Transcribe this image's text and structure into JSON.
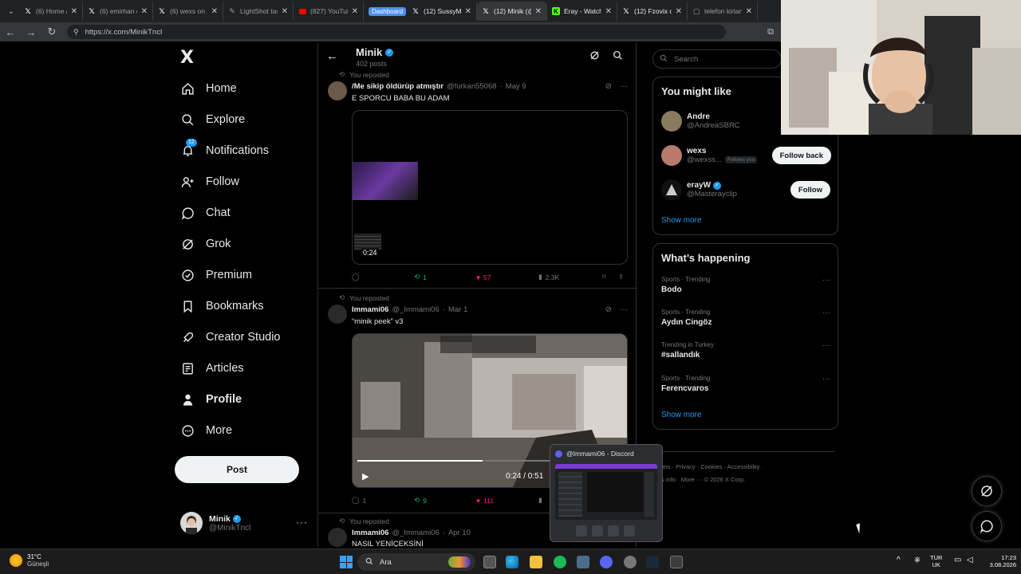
{
  "browser": {
    "tabs": [
      {
        "label": "(6) Home / X",
        "icon": "x-icon",
        "active": false
      },
      {
        "label": "(6) emirhan on X",
        "icon": "x-icon",
        "active": false
      },
      {
        "label": "(6) wexs on X",
        "icon": "x-icon",
        "active": false
      },
      {
        "label": "LightShot taslak",
        "icon": "feather-icon",
        "active": false
      },
      {
        "label": "(827) YouTube",
        "icon": "youtube-icon",
        "active": false
      },
      {
        "label": "Dashboard",
        "icon": "group-chip",
        "active": false
      },
      {
        "label": "(12) SussyMo...",
        "icon": "x-icon",
        "active": false
      },
      {
        "label": "(12) Minik (@...",
        "icon": "x-icon",
        "active": true
      },
      {
        "label": "Eray - Watch ...",
        "icon": "kick-icon",
        "active": false
      },
      {
        "label": "(12) Fzovix on...",
        "icon": "x-icon",
        "active": false
      },
      {
        "label": "telefon kirlan...",
        "icon": "page-icon",
        "active": false
      }
    ],
    "url": "https://x.com/MinikTncl"
  },
  "nav": {
    "logo": "X",
    "items": [
      {
        "label": "Home",
        "icon": "home-icon"
      },
      {
        "label": "Explore",
        "icon": "search-icon"
      },
      {
        "label": "Notifications",
        "icon": "bell-icon",
        "badge": "12"
      },
      {
        "label": "Follow",
        "icon": "add-person-icon"
      },
      {
        "label": "Chat",
        "icon": "chat-icon"
      },
      {
        "label": "Grok",
        "icon": "grok-icon"
      },
      {
        "label": "Premium",
        "icon": "premium-icon"
      },
      {
        "label": "Bookmarks",
        "icon": "bookmark-icon"
      },
      {
        "label": "Creator Studio",
        "icon": "rocket-icon"
      },
      {
        "label": "Articles",
        "icon": "article-icon"
      },
      {
        "label": "Profile",
        "icon": "person-icon"
      },
      {
        "label": "More",
        "icon": "more-circle-icon"
      }
    ],
    "post_label": "Post",
    "account": {
      "name": "Minik",
      "handle": "@MinikTncl"
    }
  },
  "profile_header": {
    "name": "Minik",
    "posts": "402 posts"
  },
  "tweets": [
    {
      "repost_label": "You reposted",
      "name": "/Me sikip öldürüp atmıştır",
      "handle": "@furkan55068",
      "date": "May 9",
      "text": "E SPORCU BABA BU ADAM",
      "video_time": "0:24",
      "replies": "",
      "reposts": "1",
      "likes": "57",
      "views": "2.3K"
    },
    {
      "repost_label": "You reposted",
      "name": "Immami06",
      "handle": "@_Immami06",
      "date": "Mar 1",
      "text": "“minik peek” v3",
      "video_time": "0:24 / 0:51",
      "replies": "1",
      "reposts": "9",
      "likes": "111",
      "views": ""
    },
    {
      "repost_label": "You reposted",
      "name": "Immami06",
      "handle": "@_Immami06",
      "date": "Apr 10",
      "text": "NASIL YENİÇEKSİNİ"
    }
  ],
  "search": {
    "placeholder": "Search"
  },
  "who_to_follow": {
    "title": "You might like",
    "users": [
      {
        "name": "Andre",
        "handle": "@AndreaSBRC",
        "verified": false,
        "button": ""
      },
      {
        "name": "wexs",
        "handle": "@wexss...",
        "follows_you": "Follows you",
        "button": "Follow back"
      },
      {
        "name": "erayW",
        "handle": "@Masterayclip",
        "verified": true,
        "button": "Follow"
      }
    ],
    "show_more": "Show more"
  },
  "trends": {
    "title": "What’s happening",
    "items": [
      {
        "context": "Sports · Trending",
        "topic": "Bodo"
      },
      {
        "context": "Sports · Trending",
        "topic": "Aydın Cingöz"
      },
      {
        "context": "Trending in Turkey",
        "topic": "#sallandık"
      },
      {
        "context": "Sports · Trending",
        "topic": "Ferencvaros"
      }
    ],
    "show_more": "Show more"
  },
  "footer": {
    "line1": "Terms · Privacy · Cookies · Accessibility ·",
    "line2": "Ads info · More ··· © 2026 X Corp."
  },
  "discord_popup": {
    "title": "@Immami06 - Discord"
  },
  "taskbar": {
    "temperature": "31°C",
    "weather": "Güneşli",
    "search_label": "Ara",
    "lang1": "TUR",
    "lang2": "UK",
    "time": "17:23",
    "date": "3.08.2026"
  },
  "colors": {
    "accent": "#1d9bf0",
    "like": "#f91880",
    "repost": "#00ba7c",
    "background": "#000000"
  }
}
